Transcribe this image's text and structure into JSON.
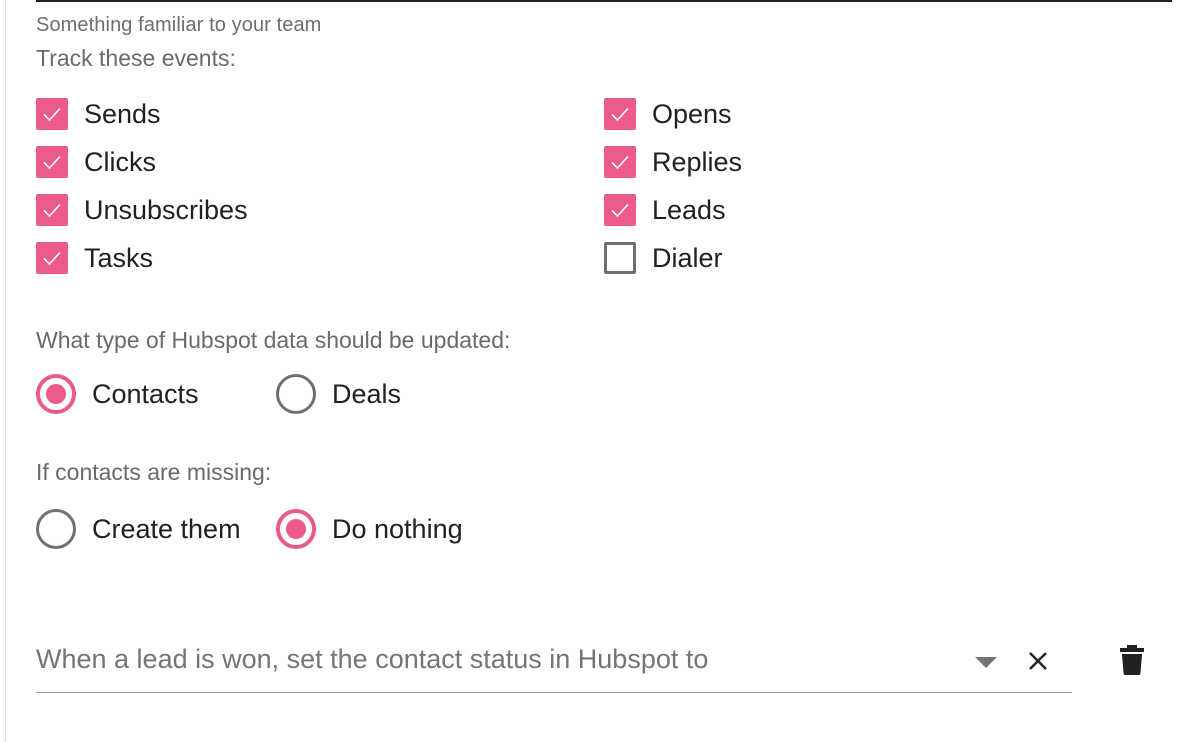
{
  "form": {
    "hint": "Something familiar to your team",
    "track_label": "Track these events:",
    "events": {
      "sends": {
        "label": "Sends",
        "checked": true
      },
      "opens": {
        "label": "Opens",
        "checked": true
      },
      "clicks": {
        "label": "Clicks",
        "checked": true
      },
      "replies": {
        "label": "Replies",
        "checked": true
      },
      "unsubscribes": {
        "label": "Unsubscribes",
        "checked": true
      },
      "leads": {
        "label": "Leads",
        "checked": true
      },
      "tasks": {
        "label": "Tasks",
        "checked": true
      },
      "dialer": {
        "label": "Dialer",
        "checked": false
      }
    },
    "data_type_label": "What type of Hubspot data should be updated:",
    "data_type_options": {
      "contacts": {
        "label": "Contacts",
        "selected": true
      },
      "deals": {
        "label": "Deals",
        "selected": false
      }
    },
    "missing_label": "If contacts are missing:",
    "missing_options": {
      "create": {
        "label": "Create them",
        "selected": false
      },
      "nothing": {
        "label": "Do nothing",
        "selected": true
      }
    },
    "status_select": {
      "placeholder": "When a lead is won, set the contact status in Hubspot to",
      "value": ""
    }
  },
  "icons": {
    "check": "check-icon",
    "dropdown": "dropdown-arrow-icon",
    "clear": "close-icon",
    "delete": "trash-icon"
  },
  "colors": {
    "accent": "#ec5a8a",
    "label_gray": "#6a6a6a",
    "text": "#212121",
    "border_gray": "#6f6f6f"
  }
}
